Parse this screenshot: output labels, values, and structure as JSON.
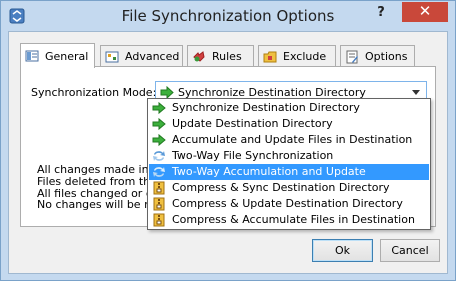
{
  "window": {
    "title": "File Synchronization Options",
    "help_label": "?",
    "close_label": "✕"
  },
  "tabs": [
    {
      "label": "General",
      "icon": "general-icon"
    },
    {
      "label": "Advanced",
      "icon": "advanced-icon"
    },
    {
      "label": "Rules",
      "icon": "rules-icon"
    },
    {
      "label": "Exclude",
      "icon": "exclude-icon"
    },
    {
      "label": "Options",
      "icon": "options-icon"
    }
  ],
  "general": {
    "mode_label": "Synchronization Mode:",
    "selected_mode": "Synchronize Destination Directory",
    "description": [
      "All changes made in t",
      "Files deleted from the",
      "All files changed or de",
      "No changes will be ma"
    ]
  },
  "dropdown": {
    "options": [
      {
        "label": "Synchronize Destination Directory",
        "icon": "arrow-right-icon"
      },
      {
        "label": "Update Destination Directory",
        "icon": "arrow-right-icon"
      },
      {
        "label": "Accumulate and Update Files in Destination",
        "icon": "arrow-right-icon"
      },
      {
        "label": "Two-Way File Synchronization",
        "icon": "two-way-sync-icon"
      },
      {
        "label": "Two-Way Accumulation and Update",
        "icon": "two-way-sync-icon"
      },
      {
        "label": "Compress & Sync Destination Directory",
        "icon": "archive-icon"
      },
      {
        "label": "Compress & Update Destination Directory",
        "icon": "archive-icon"
      },
      {
        "label": "Compress & Accumulate Files in Destination",
        "icon": "archive-icon"
      }
    ],
    "highlighted_index": 4
  },
  "buttons": {
    "ok_label": "Ok",
    "cancel_label": "Cancel"
  },
  "colors": {
    "titlebar": "#c4d9ef",
    "close": "#c9483a",
    "highlight": "#3399ff",
    "combo_border": "#7eb4ea"
  }
}
